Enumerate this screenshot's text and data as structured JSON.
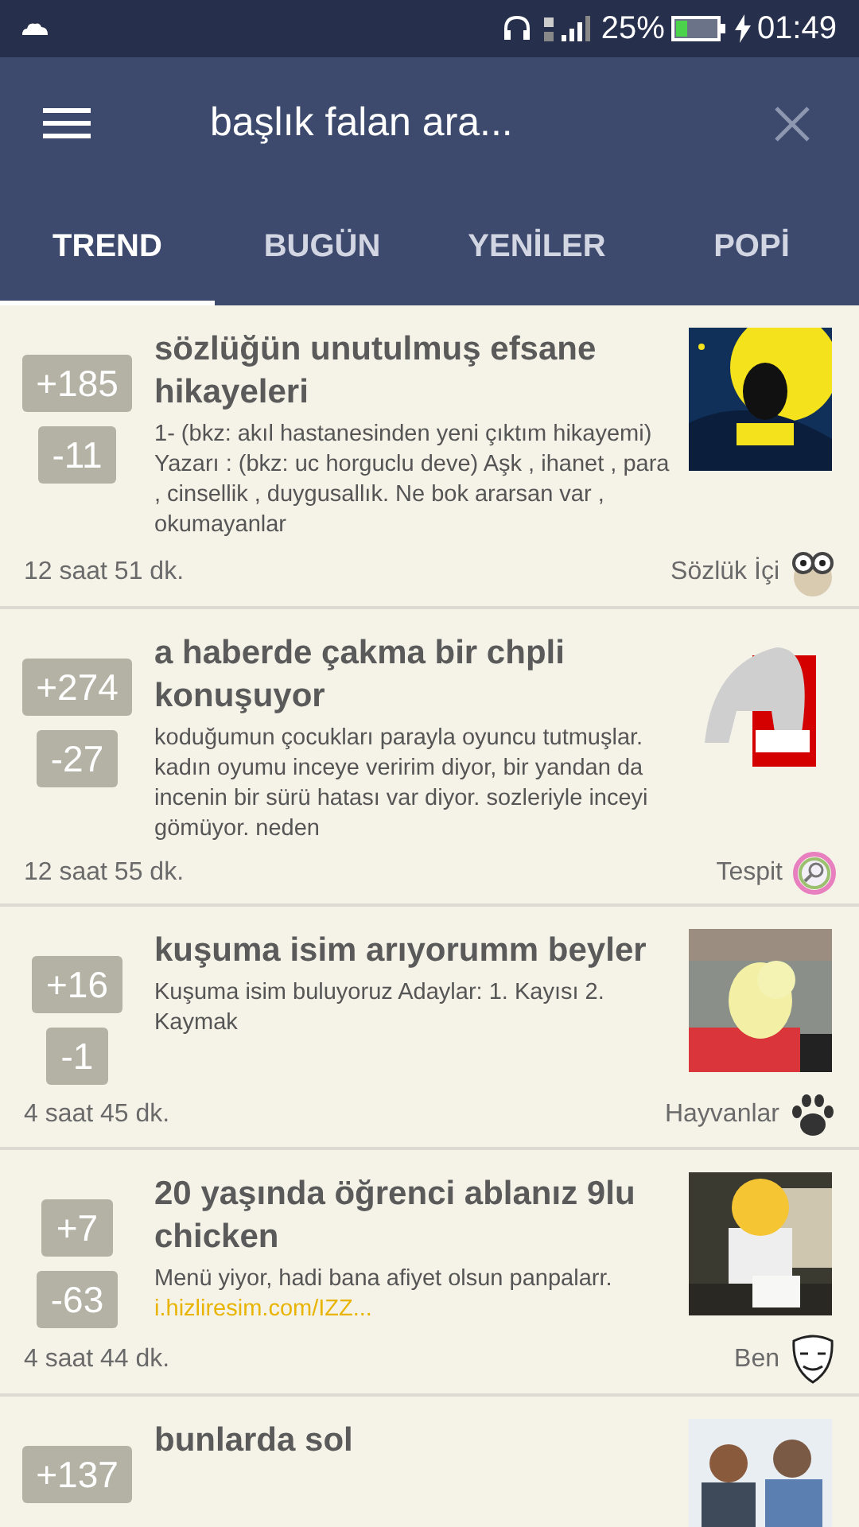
{
  "status_bar": {
    "battery": "25%",
    "time": "01:49"
  },
  "app_bar": {
    "search": {
      "placeholder": "başlık falan ara..."
    }
  },
  "tabs": [
    {
      "label": "TREND",
      "selected": true
    },
    {
      "label": "BUGÜN",
      "selected": false
    },
    {
      "label": "YENİLER",
      "selected": false
    },
    {
      "label": "POPİ",
      "selected": false
    }
  ],
  "posts": [
    {
      "upvotes": "+185",
      "downvotes": "-11",
      "title": "sözlüğün unutulmuş efsane hikayeleri",
      "excerpt": "1- (bkz: akıl hastanesinden yeni çıktım hikayemi) Yazarı : (bkz: uc horguclu deve) Aşk , ihanet , para , cinsellik , duygusallık. Ne bok ararsan var , okumayanlar",
      "time": "12 saat 51 dk.",
      "category": {
        "label": "Sözlük İçi",
        "kind": "owl"
      }
    },
    {
      "upvotes": "+274",
      "downvotes": "-27",
      "title": "a haberde çakma bir chpli konuşuyor",
      "excerpt": "koduğumun çocukları parayla oyuncu tutmuşlar. kadın oyumu inceye veririm diyor, bir yandan da incenin bir sürü hatası var diyor. sozleriyle inceyi gömüyor. neden",
      "time": "12 saat 55 dk.",
      "category": {
        "label": "Tespit",
        "kind": "lens"
      }
    },
    {
      "upvotes": "+16",
      "downvotes": "-1",
      "title": "kuşuma isim arıyorumm beyler",
      "excerpt": "Kuşuma isim buluyoruz Adaylar: 1. Kayısı 2. Kaymak",
      "time": "4 saat 45 dk.",
      "category": {
        "label": "Hayvanlar",
        "kind": "paw"
      }
    },
    {
      "upvotes": "+7",
      "downvotes": "-63",
      "title": "20 yaşında öğrenci ablanız 9lu chicken",
      "excerpt": "Menü yiyor, hadi bana afiyet olsun panpalarr.",
      "link": "i.hizliresim.com/IZZ...",
      "time": "4 saat 44 dk.",
      "category": {
        "label": "Ben",
        "kind": "mask"
      }
    },
    {
      "upvotes": "+137",
      "title": "bunlarda sol"
    }
  ]
}
